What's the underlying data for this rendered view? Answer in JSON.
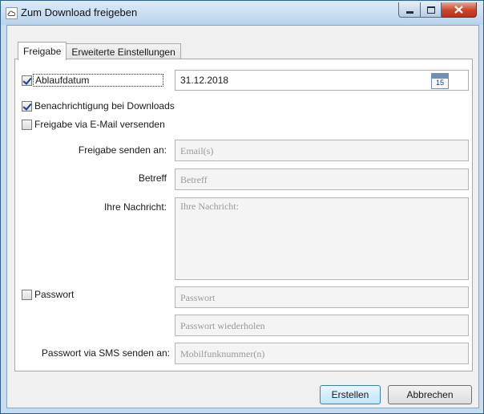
{
  "window": {
    "title": "Zum Download freigeben",
    "colors": {
      "titlebar": "#c7dcef",
      "close": "#c9452a",
      "check": "#1c3d8c"
    }
  },
  "tabs": [
    {
      "label": "Freigabe",
      "active": true
    },
    {
      "label": "Erweiterte Einstellungen",
      "active": false
    }
  ],
  "form": {
    "expiry": {
      "label": "Ablaufdatum",
      "checked": true,
      "value": "31.12.2018",
      "calendar_day": "15"
    },
    "notify": {
      "label": "Benachrichtigung bei Downloads",
      "checked": true
    },
    "email_share": {
      "label": "Freigabe via E-Mail versenden",
      "checked": false
    },
    "send_to": {
      "label": "Freigabe senden an:",
      "placeholder": "Email(s)"
    },
    "subject": {
      "label": "Betreff",
      "placeholder": "Betreff"
    },
    "message": {
      "label": "Ihre Nachricht:",
      "placeholder": "Ihre Nachricht:"
    },
    "password": {
      "label": "Passwort",
      "checked": false,
      "placeholder": "Passwort",
      "repeat_placeholder": "Passwort wiederholen"
    },
    "sms": {
      "label": "Passwort via SMS senden an:",
      "placeholder": "Mobilfunknummer(n)"
    }
  },
  "buttons": {
    "create": "Erstellen",
    "cancel": "Abbrechen"
  }
}
